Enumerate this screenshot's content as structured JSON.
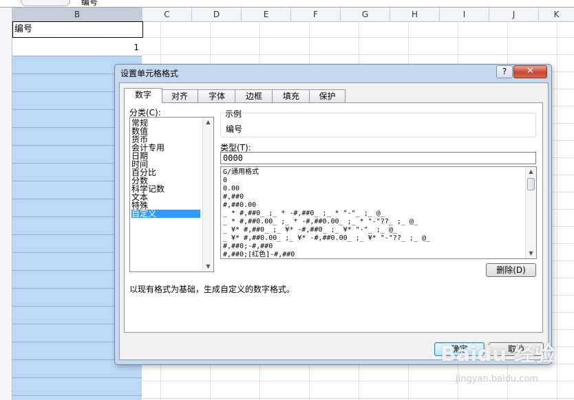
{
  "formula_bar": {
    "content": "编号"
  },
  "columns": [
    {
      "label": "B",
      "selected": true
    },
    {
      "label": "C"
    },
    {
      "label": "D"
    },
    {
      "label": "E"
    },
    {
      "label": "F"
    },
    {
      "label": "G"
    },
    {
      "label": "H"
    },
    {
      "label": "I"
    },
    {
      "label": "J"
    },
    {
      "label": "K"
    }
  ],
  "cells": {
    "B1": "编号",
    "B2": "1"
  },
  "dialog": {
    "title": "设置单元格格式",
    "help_label": "?",
    "close_label": "✕",
    "tabs": [
      "数字",
      "对齐",
      "字体",
      "边框",
      "填充",
      "保护"
    ],
    "active_tab": "数字",
    "category_label": "分类(C):",
    "categories": [
      "常规",
      "数值",
      "货币",
      "会计专用",
      "日期",
      "时间",
      "百分比",
      "分数",
      "科学记数",
      "文本",
      "特殊",
      "自定义"
    ],
    "selected_category": "自定义",
    "sample_label": "示例",
    "sample_value": "编号",
    "type_label": "类型(T):",
    "type_value": "0000",
    "formats": [
      "G/通用格式",
      "0",
      "0.00",
      "#,##0",
      "#,##0.00",
      "_ * #,##0_ ;_ * -#,##0_ ;_ * \"-\"_ ;_ @_",
      "_ * #,##0.00_ ;_ * -#,##0.00_ ;_ * \"-\"??_ ;_ @_",
      "_ ¥* #,##0_ ;_ ¥* -#,##0_ ;_ ¥* \"-\"_ ;_ @_",
      "_ ¥* #,##0.00_ ;_ ¥* -#,##0.00_ ;_ ¥* \"-\"??_ ;_ @_",
      "#,##0;-#,##0",
      "#,##0;[红色]-#,##0"
    ],
    "delete_label": "删除(D)",
    "description": "以现有格式为基础，生成自定义的数字格式。",
    "ok_label": "确定",
    "cancel_label": "取消"
  },
  "watermark": {
    "logo": "Baidu 经验",
    "url": "jingyan.baidu.com"
  },
  "colors": {
    "selection_fill": "#bcd9f7",
    "dialog_frame": "#c6d8ee",
    "list_highlight": "#3399ff",
    "close_red": "#c8452f"
  }
}
